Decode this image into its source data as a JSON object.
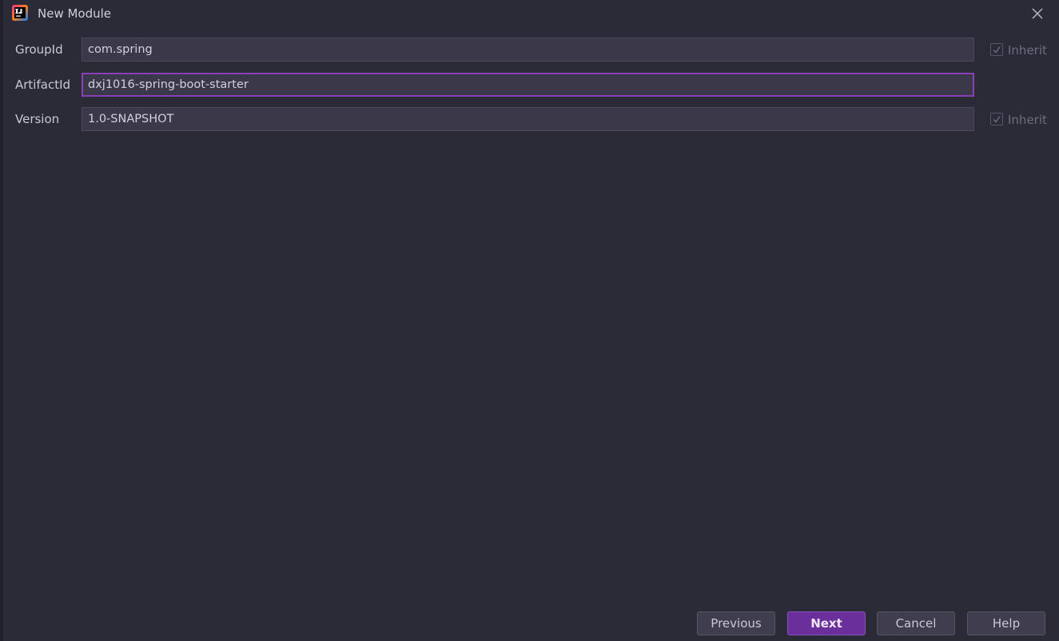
{
  "window": {
    "title": "New Module"
  },
  "form": {
    "groupId": {
      "label": "GroupId",
      "value": "com.spring",
      "inherit_label": "Inherit",
      "inherit_checked": true
    },
    "artifactId": {
      "label": "ArtifactId",
      "value": "dxj1016-spring-boot-starter"
    },
    "version": {
      "label": "Version",
      "value": "1.0-SNAPSHOT",
      "inherit_label": "Inherit",
      "inherit_checked": true
    }
  },
  "buttons": {
    "previous": "Previous",
    "next": "Next",
    "cancel": "Cancel",
    "help": "Help"
  },
  "colors": {
    "background": "#2b2a37",
    "input_bg": "#3a3849",
    "focus_border": "#8a3fb8",
    "primary_button": "#6a2f9a"
  },
  "icons": {
    "app": "intellij-idea-icon",
    "close": "close-icon",
    "check": "check-icon"
  }
}
